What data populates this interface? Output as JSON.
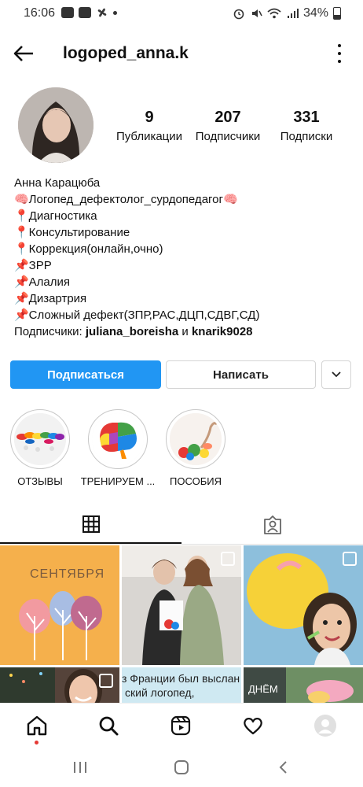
{
  "status_bar": {
    "time": "16:06",
    "battery": "34%"
  },
  "header": {
    "username": "logoped_anna.k"
  },
  "stats": [
    {
      "value": "9",
      "label": "Публикации"
    },
    {
      "value": "207",
      "label": "Подписчики"
    },
    {
      "value": "331",
      "label": "Подписки"
    }
  ],
  "bio": {
    "name": "Анна Карацюба",
    "lines": [
      "🧠Логопед_дефектолог_сурдопедагог🧠",
      "📍Диагностика",
      "📍Консультирование",
      "📍Коррекция(онлайн,очно)",
      "📌ЗРР",
      "📌Алалия",
      "📌Дизартрия",
      "📌Сложный дефект(ЗПР,РАС,ДЦП,СДВГ,СД)"
    ],
    "followers_prefix": "Подписчики: ",
    "follower1": "juliana_boreisha",
    "followers_and": " и ",
    "follower2": "knarik9028"
  },
  "buttons": {
    "follow": "Подписаться",
    "message": "Написать"
  },
  "highlights": [
    {
      "label": "ОТЗЫВЫ"
    },
    {
      "label": "ТРЕНИРУЕМ ..."
    },
    {
      "label": "ПОСОБИЯ"
    }
  ],
  "posts": {
    "p1_text": "СЕНТЯБРЯ",
    "p5_line1": "з Франции был выслан",
    "p5_line2": "ский логопед,",
    "p6_text": "ДНЁМ"
  },
  "colors": {
    "accent": "#2196f3",
    "post1_bg": "#f5b04c"
  }
}
